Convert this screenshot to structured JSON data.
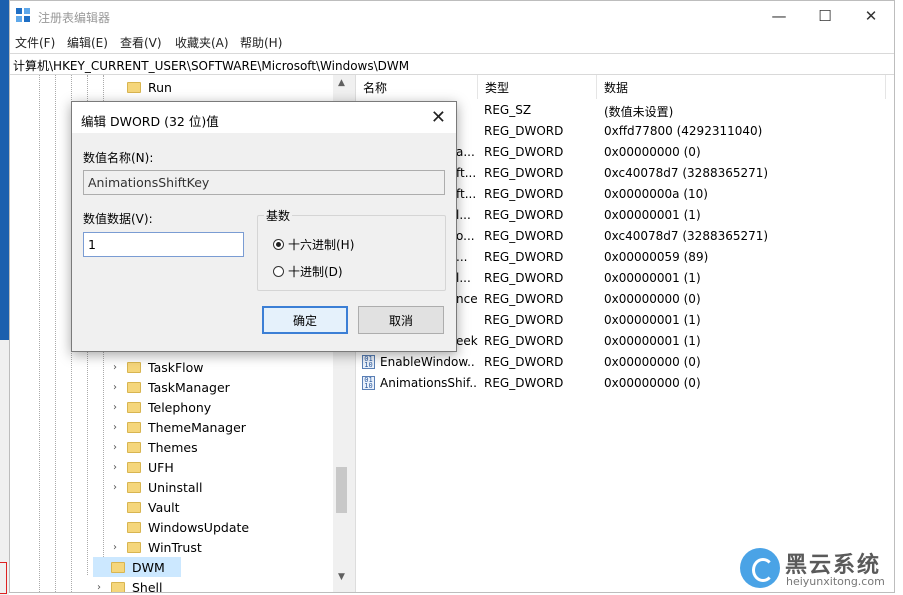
{
  "window": {
    "title": "注册表编辑器",
    "btn_min": "—",
    "btn_max": "☐",
    "btn_close": "✕"
  },
  "menu": [
    "文件(F)",
    "编辑(E)",
    "查看(V)",
    "收藏夹(A)",
    "帮助(H)"
  ],
  "address": "计算机\\HKEY_CURRENT_USER\\SOFTWARE\\Microsoft\\Windows\\DWM",
  "tree": {
    "items": [
      {
        "label": "Run",
        "chevron": ""
      },
      {
        "label": "TaskFlow",
        "chevron": "›"
      },
      {
        "label": "TaskManager",
        "chevron": "›"
      },
      {
        "label": "Telephony",
        "chevron": "›"
      },
      {
        "label": "ThemeManager",
        "chevron": "›"
      },
      {
        "label": "Themes",
        "chevron": "›"
      },
      {
        "label": "UFH",
        "chevron": "›"
      },
      {
        "label": "Uninstall",
        "chevron": "›"
      },
      {
        "label": "Vault",
        "chevron": ""
      },
      {
        "label": "WindowsUpdate",
        "chevron": ""
      },
      {
        "label": "WinTrust",
        "chevron": "›"
      },
      {
        "label": "DWM",
        "chevron": ""
      },
      {
        "label": "Shell",
        "chevron": "›"
      }
    ],
    "scroll_up": "▲",
    "scroll_down": "▼"
  },
  "list": {
    "columns": [
      "名称",
      "类型",
      "数据"
    ],
    "rows": [
      {
        "name": "",
        "type": "REG_SZ",
        "data": "(数值未设置)"
      },
      {
        "name": "",
        "type": "REG_DWORD",
        "data": "0xffd77800 (4292311040)"
      },
      {
        "name": "a...",
        "type": "REG_DWORD",
        "data": "0x00000000 (0)"
      },
      {
        "name": "ft...",
        "type": "REG_DWORD",
        "data": "0xc40078d7 (3288365271)"
      },
      {
        "name": "ft...",
        "type": "REG_DWORD",
        "data": "0x0000000a (10)"
      },
      {
        "name": "l...",
        "type": "REG_DWORD",
        "data": "0x00000001 (1)"
      },
      {
        "name": "o...",
        "type": "REG_DWORD",
        "data": "0xc40078d7 (3288365271)"
      },
      {
        "name": "...",
        "type": "REG_DWORD",
        "data": "0x00000059 (89)"
      },
      {
        "name": "l...",
        "type": "REG_DWORD",
        "data": "0x00000001 (1)"
      },
      {
        "name": "nce",
        "type": "REG_DWORD",
        "data": "0x00000000 (0)"
      },
      {
        "name": "",
        "type": "REG_DWORD",
        "data": "0x00000001 (1)"
      },
      {
        "name": "eek",
        "type": "REG_DWORD",
        "data": "0x00000001 (1)"
      },
      {
        "name": "EnableWindow...",
        "type": "REG_DWORD",
        "data": "0x00000000 (0)"
      },
      {
        "name": "AnimationsShif...",
        "type": "REG_DWORD",
        "data": "0x00000000 (0)"
      }
    ]
  },
  "dialog": {
    "title": "编辑 DWORD (32 位)值",
    "close": "✕",
    "name_label": "数值名称(N):",
    "name_value": "AnimationsShiftKey",
    "value_label": "数值数据(V):",
    "value": "1",
    "base_label": "基数",
    "radio_hex": "十六进制(H)",
    "radio_dec": "十进制(D)",
    "selected_base": "hex",
    "ok": "确定",
    "cancel": "取消"
  },
  "watermark": {
    "brand": "黑云系统",
    "site": "heiyunxitong.com"
  },
  "colors": {
    "accent": "#3c7fd5",
    "desktop": "#1b5fae",
    "folder": "#f5d67b",
    "watermark_logo": "#4aa3e6"
  }
}
